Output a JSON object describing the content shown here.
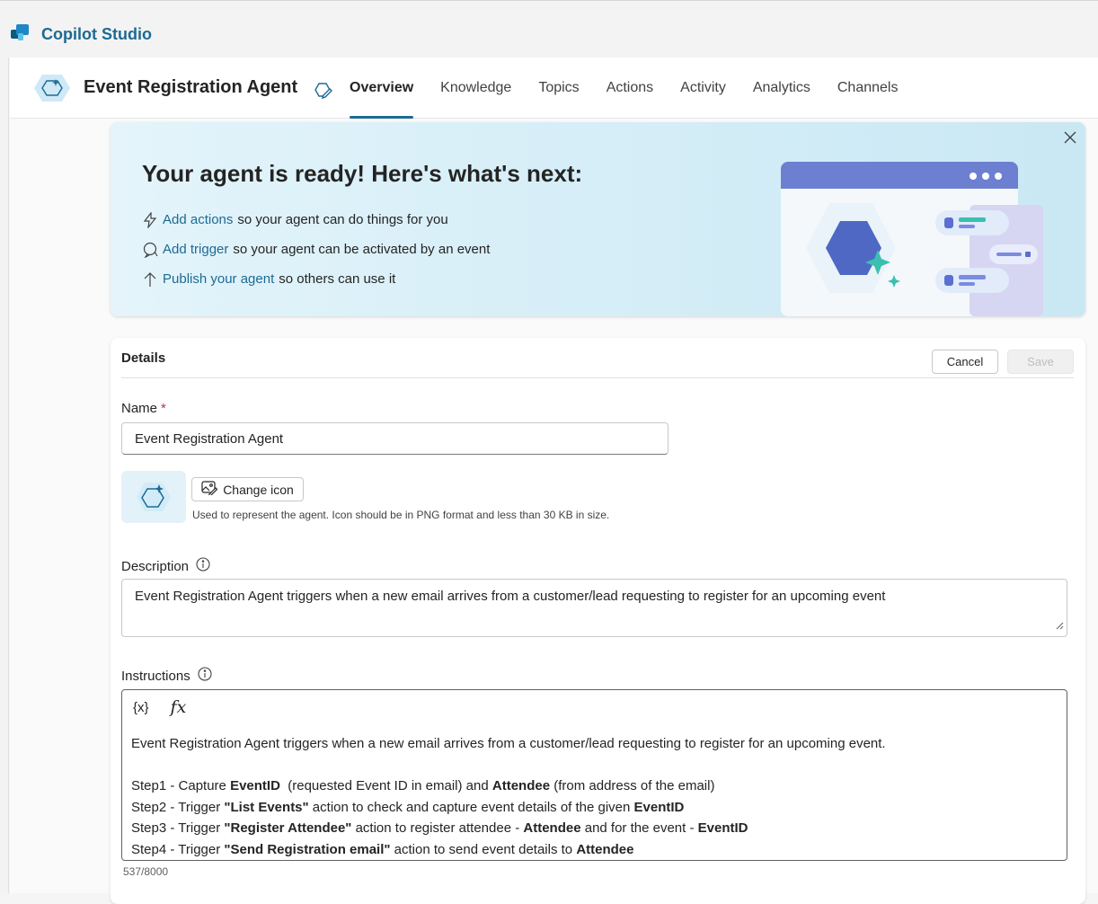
{
  "app": {
    "name": "Copilot Studio",
    "colors": {
      "brand": "#1d6a93",
      "accent": "#1d6a93",
      "required": "#c4314b"
    }
  },
  "agent": {
    "title": "Event Registration Agent",
    "tabs": [
      {
        "label": "Overview",
        "active": true
      },
      {
        "label": "Knowledge"
      },
      {
        "label": "Topics"
      },
      {
        "label": "Actions"
      },
      {
        "label": "Activity"
      },
      {
        "label": "Analytics"
      },
      {
        "label": "Channels"
      }
    ]
  },
  "banner": {
    "title": "Your agent is ready! Here's what's next:",
    "items": [
      {
        "icon": "lightning-icon",
        "link": "Add actions",
        "text": "so your agent can do things for you"
      },
      {
        "icon": "chat-icon",
        "link": "Add trigger",
        "text": "so your agent can be activated by an event"
      },
      {
        "icon": "arrow-up-icon",
        "link": "Publish your agent",
        "text": "so others can use it"
      }
    ]
  },
  "details": {
    "heading": "Details",
    "cancel_label": "Cancel",
    "save_label": "Save",
    "name_label": "Name",
    "required_mark": "*",
    "name_value": "Event Registration Agent",
    "change_icon_label": "Change icon",
    "icon_help": "Used to represent the agent. Icon should be in PNG format and less than 30 KB in size.",
    "description_label": "Description",
    "description_value": "Event Registration Agent triggers when a new email arrives from a customer/lead requesting to register for an upcoming event",
    "instructions_label": "Instructions",
    "instructions_tools": {
      "variable": "{x}",
      "formula": "fx"
    },
    "instructions_intro": "Event Registration Agent triggers when a new email arrives from a customer/lead requesting to register for an upcoming event.",
    "instructions_steps": [
      {
        "segments": [
          {
            "t": "Step1 - Capture ",
            "b": false
          },
          {
            "t": "EventID",
            "b": true
          },
          {
            "t": "  (requested Event ID in email) and ",
            "b": false
          },
          {
            "t": "Attendee",
            "b": true
          },
          {
            "t": " (from address of the email)",
            "b": false
          }
        ]
      },
      {
        "segments": [
          {
            "t": "Step2 - Trigger ",
            "b": false
          },
          {
            "t": "\"List Events\"",
            "b": true
          },
          {
            "t": " action to check and capture event details of the given ",
            "b": false
          },
          {
            "t": "EventID",
            "b": true
          }
        ]
      },
      {
        "segments": [
          {
            "t": "Step3 - Trigger ",
            "b": false
          },
          {
            "t": "\"Register Attendee\"",
            "b": true
          },
          {
            "t": " action to register attendee - ",
            "b": false
          },
          {
            "t": "Attendee",
            "b": true
          },
          {
            "t": " and for the event - ",
            "b": false
          },
          {
            "t": "EventID",
            "b": true
          }
        ]
      },
      {
        "segments": [
          {
            "t": "Step4 - Trigger ",
            "b": false
          },
          {
            "t": "\"Send Registration email\"",
            "b": true
          },
          {
            "t": " action to send event details to ",
            "b": false
          },
          {
            "t": "Attendee",
            "b": true
          }
        ]
      }
    ],
    "char_count": "537/8000"
  }
}
